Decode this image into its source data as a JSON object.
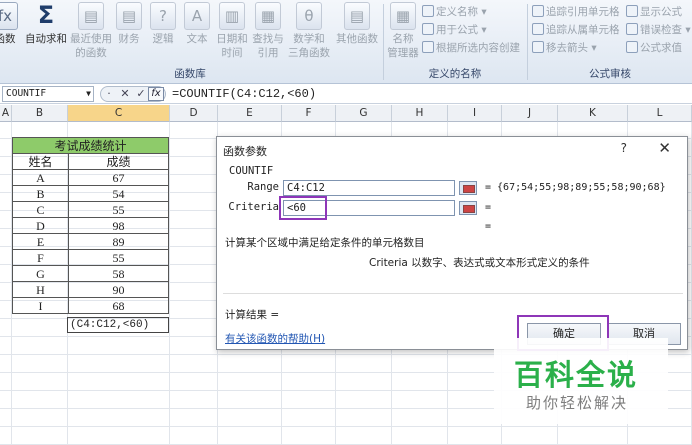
{
  "ribbon": {
    "buttons": [
      {
        "icon": "insert-function-icon",
        "glyph": "fx",
        "label": "函数",
        "sub": ""
      },
      {
        "icon": "autosum-icon",
        "glyph": "Σ",
        "label": "自动求和",
        "sub": ""
      },
      {
        "icon": "recent-functions-icon",
        "glyph": "▤",
        "label": "最近使用",
        "sub": "的函数"
      },
      {
        "icon": "financial-icon",
        "glyph": "▤",
        "label": "财务",
        "sub": ""
      },
      {
        "icon": "logical-icon",
        "glyph": "?",
        "label": "逻辑",
        "sub": ""
      },
      {
        "icon": "text-icon",
        "glyph": "A",
        "label": "文本",
        "sub": ""
      },
      {
        "icon": "date-time-icon",
        "glyph": "▥",
        "label": "日期和",
        "sub": "时间"
      },
      {
        "icon": "lookup-icon",
        "glyph": "▦",
        "label": "查找与",
        "sub": "引用"
      },
      {
        "icon": "math-trig-icon",
        "glyph": "θ",
        "label": "数学和",
        "sub": "三角函数"
      },
      {
        "icon": "more-functions-icon",
        "glyph": "▤",
        "label": "其他函数",
        "sub": ""
      },
      {
        "icon": "name-manager-icon",
        "glyph": "▦",
        "label": "名称",
        "sub": "管理器"
      }
    ],
    "group_function_library": "函数库",
    "define_name": "定义名称",
    "use_in_formula": "用于公式",
    "create_from_selection": "根据所选内容创建",
    "group_defined_names": "定义的名称",
    "trace_precedents": "追踪引用单元格",
    "trace_dependents": "追踪从属单元格",
    "remove_arrows": "移去箭头",
    "show_formulas": "显示公式",
    "error_checking": "错误检查",
    "evaluate_formula": "公式求值",
    "group_formula_auditing": "公式审核"
  },
  "formula_bar": {
    "name_box": "COUNTIF",
    "formula": "=COUNTIF(C4:C12,<60)",
    "cancel": "✕",
    "enter": "✓",
    "fx": "fx"
  },
  "columns": [
    "A",
    "B",
    "C",
    "D",
    "E",
    "F",
    "G",
    "H",
    "I",
    "J",
    "K",
    "L"
  ],
  "sheet": {
    "title": "考试成绩统计",
    "headers": [
      "姓名",
      "成绩"
    ],
    "rows": [
      [
        "A",
        "67"
      ],
      [
        "B",
        "54"
      ],
      [
        "C",
        "55"
      ],
      [
        "D",
        "98"
      ],
      [
        "E",
        "89"
      ],
      [
        "F",
        "55"
      ],
      [
        "G",
        "58"
      ],
      [
        "H",
        "90"
      ],
      [
        "I",
        "68"
      ]
    ],
    "edit_cell": "(C4:C12,<60)"
  },
  "dialog": {
    "title": "函数参数",
    "help_icon": "?",
    "close_icon": "✕",
    "function_name": "COUNTIF",
    "range_label": "Range",
    "range_value": "C4:C12",
    "range_result": "=  {67;54;55;98;89;55;58;90;68}",
    "criteria_label": "Criteria",
    "criteria_value": "<60",
    "criteria_result": "=",
    "total_result": "=",
    "description": "计算某个区域中满足给定条件的单元格数目",
    "arg_description": "Criteria  以数字、表达式或文本形式定义的条件",
    "calc_result": "计算结果 =",
    "help_link": "有关该函数的帮助(H)",
    "ok": "确定",
    "cancel": "取消"
  },
  "watermark": {
    "main": "百科全说",
    "sub": "助你轻松解决"
  },
  "colors": {
    "header_green": "#8ecb6a",
    "highlight": "#8e36b8",
    "watermark_green": "#2bb04a"
  }
}
